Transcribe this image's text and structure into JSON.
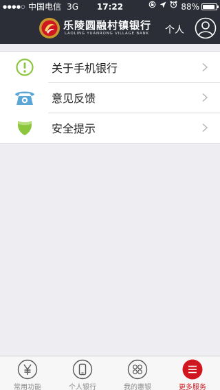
{
  "status_bar": {
    "signal": "●●●●○",
    "carrier": "中国电信",
    "network": "3G",
    "time": "17:22",
    "icons": [
      "rotation-lock-icon",
      "location-icon",
      "alarm-icon"
    ],
    "battery": "88%",
    "battery_level": 0.88
  },
  "header": {
    "bank_name": "乐陵圆融村镇银行",
    "bank_name_en": "LAOLING YUANRONG VILLAGE BANK",
    "user_label": "个人"
  },
  "menu": {
    "items": [
      {
        "label": "关于手机银行",
        "icon": "info-icon"
      },
      {
        "label": "意见反馈",
        "icon": "telephone-icon"
      },
      {
        "label": "安全提示",
        "icon": "shield-icon"
      }
    ]
  },
  "tabbar": {
    "tabs": [
      {
        "label": "常用功能",
        "icon": "yen-icon"
      },
      {
        "label": "个人银行",
        "icon": "phone-icon"
      },
      {
        "label": "我的惠银",
        "icon": "grid-icon"
      },
      {
        "label": "更多服务",
        "icon": "menu-icon"
      }
    ],
    "active_index": 3
  },
  "colors": {
    "header_bg": "#2b2e37",
    "accent": "#d0161e",
    "info_green": "#8cc63e",
    "phone_blue": "#5aa7d6",
    "shield_green": "#8cc63e"
  }
}
